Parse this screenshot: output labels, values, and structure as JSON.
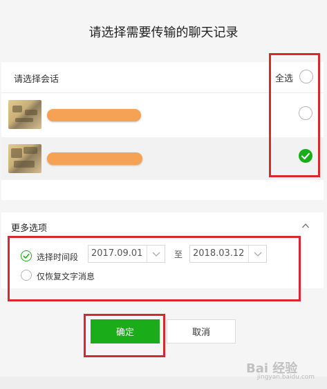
{
  "dialog": {
    "title": "请选择需要传输的聊天记录"
  },
  "sessions": {
    "header_label": "请选择会话",
    "select_all_label": "全选",
    "items": [
      {
        "selected": false
      },
      {
        "selected": true
      }
    ]
  },
  "more_options": {
    "title": "更多选项",
    "time_range": {
      "label": "选择时间段",
      "checked": true,
      "start_date": "2017.09.01",
      "to_label": "至",
      "end_date": "2018.03.12"
    },
    "text_only": {
      "label": "仅恢复文字消息",
      "checked": false
    }
  },
  "buttons": {
    "confirm_label": "确定",
    "cancel_label": "取消"
  },
  "watermark": {
    "text": "Bai 经验",
    "sub": "jingyan.baidu.com"
  },
  "colors": {
    "accent_green": "#1aad19",
    "highlight_red": "#d8282f",
    "name_redaction": "#f5a255"
  }
}
